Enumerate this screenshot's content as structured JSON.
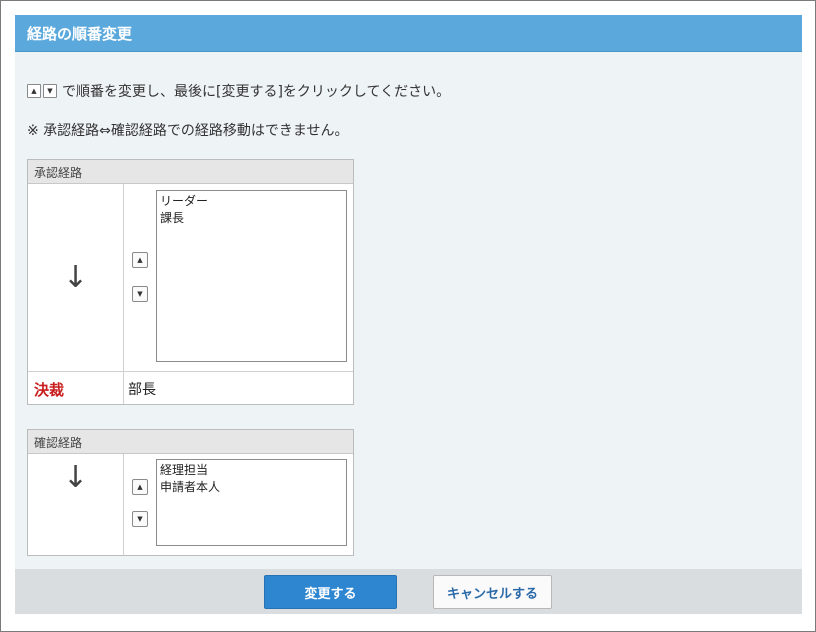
{
  "dialog": {
    "title": "経路の順番変更"
  },
  "instruction": {
    "up_icon": "▲",
    "down_icon": "▼",
    "text": "で順番を変更し、最後に[変更する]をクリックしてください。"
  },
  "note": "※ 承認経路⇔確認経路での経路移動はできません。",
  "approval_route": {
    "heading": "承認経路",
    "arrow": "↓",
    "up_icon": "▲",
    "down_icon": "▼",
    "items": [
      "リーダー",
      "課長"
    ],
    "final_label": "決裁",
    "final_value": "部長"
  },
  "confirm_route": {
    "heading": "確認経路",
    "arrow": "↓",
    "up_icon": "▲",
    "down_icon": "▼",
    "items": [
      "経理担当",
      "申請者本人"
    ]
  },
  "footer": {
    "submit_label": "変更する",
    "cancel_label": "キャンセルする"
  },
  "colors": {
    "header_bg": "#5ba9dc",
    "primary_button": "#2e86d1",
    "final_label": "#c81e1e"
  }
}
